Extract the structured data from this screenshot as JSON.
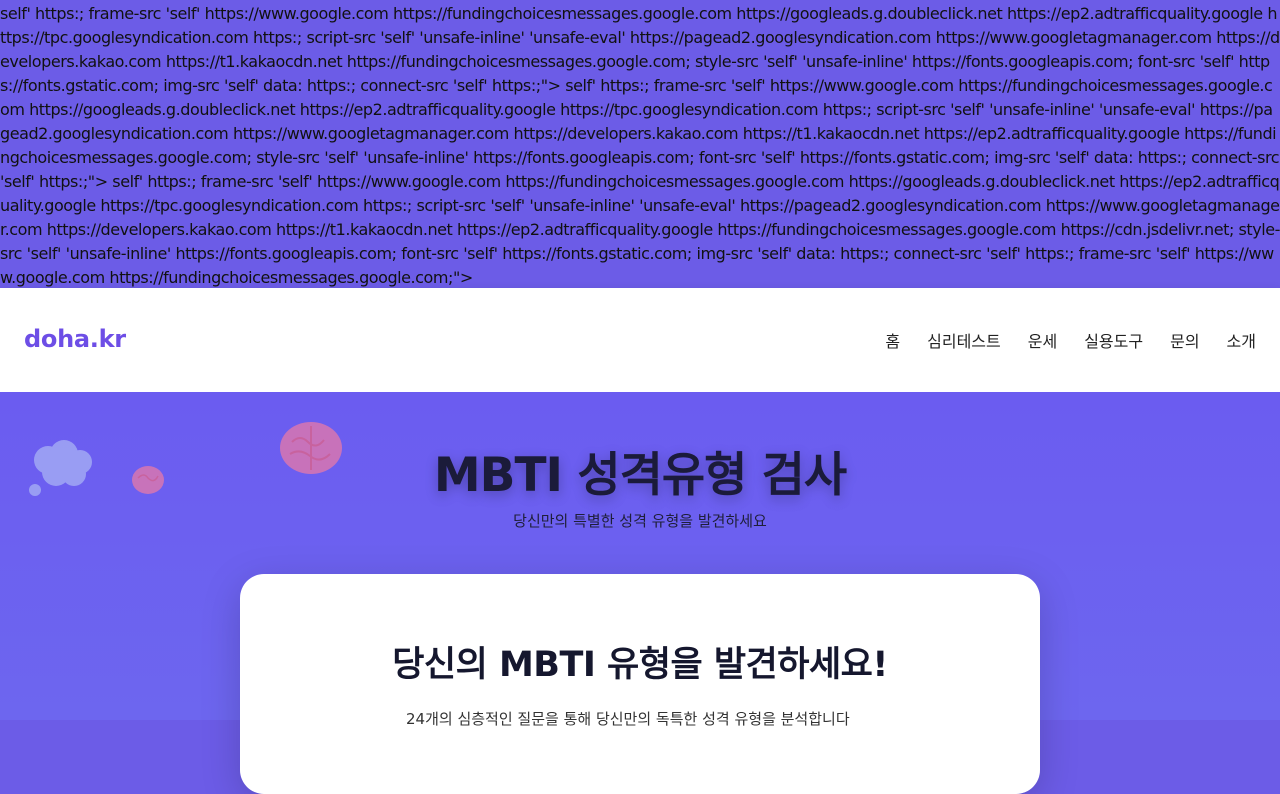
{
  "leaked_text": "self' https:; frame-src 'self' https://www.google.com https://fundingchoicesmessages.google.com https://googleads.g.doubleclick.net https://ep2.adtrafficquality.google https://tpc.googlesyndication.com https:; script-src 'self' 'unsafe-inline' 'unsafe-eval' https://pagead2.googlesyndication.com https://www.googletagmanager.com https://developers.kakao.com https://t1.kakaocdn.net https://fundingchoicesmessages.google.com; style-src 'self' 'unsafe-inline' https://fonts.googleapis.com; font-src 'self' https://fonts.gstatic.com; img-src 'self' data: https:; connect-src 'self' https:;\"> self' https:; frame-src 'self' https://www.google.com https://fundingchoicesmessages.google.com https://googleads.g.doubleclick.net https://ep2.adtrafficquality.google https://tpc.googlesyndication.com https:; script-src 'self' 'unsafe-inline' 'unsafe-eval' https://pagead2.googlesyndication.com https://www.googletagmanager.com https://developers.kakao.com https://t1.kakaocdn.net https://ep2.adtrafficquality.google https://fundingchoicesmessages.google.com; style-src 'self' 'unsafe-inline' https://fonts.googleapis.com; font-src 'self' https://fonts.gstatic.com; img-src 'self' data: https:; connect-src 'self' https:;\"> self' https:; frame-src 'self' https://www.google.com https://fundingchoicesmessages.google.com https://googleads.g.doubleclick.net https://ep2.adtrafficquality.google https://tpc.googlesyndication.com https:; script-src 'self' 'unsafe-inline' 'unsafe-eval' https://pagead2.googlesyndication.com https://www.googletagmanager.com https://developers.kakao.com https://t1.kakaocdn.net https://ep2.adtrafficquality.google https://fundingchoicesmessages.google.com https://cdn.jsdelivr.net; style-src 'self' 'unsafe-inline' https://fonts.googleapis.com; font-src 'self' https://fonts.gstatic.com; img-src 'self' data: https:; connect-src 'self' https:; frame-src 'self' https://www.google.com https://fundingchoicesmessages.google.com;\">",
  "header": {
    "logo": "doha.kr",
    "nav": [
      "홈",
      "심리테스트",
      "운세",
      "실용도구",
      "문의",
      "소개"
    ]
  },
  "hero": {
    "title": "MBTI 성격유형 검사",
    "subtitle": "당신만의 특별한 성격 유형을 발견하세요"
  },
  "card": {
    "title": "당신의 MBTI 유형을 발견하세요!",
    "description": "24개의 심층적인 질문을 통해 당신만의 독특한 성격 유형을 분석합니다"
  },
  "colors": {
    "background": "#6c5ce7",
    "logo": "#6d4ee6",
    "title": "#1b1b3a"
  },
  "icons": [
    "thought-cloud-icon",
    "brain-icon",
    "brain-small-icon"
  ]
}
